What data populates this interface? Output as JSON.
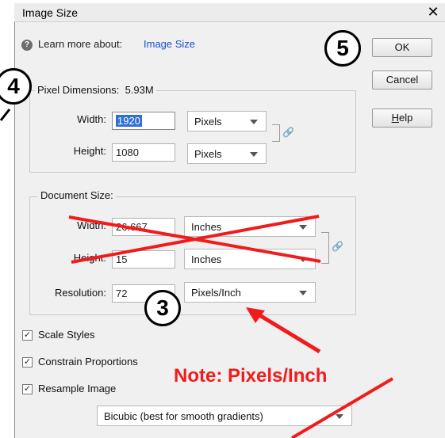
{
  "dialog": {
    "title": "Image Size",
    "close_glyph": "✕",
    "learn_more": {
      "icon": "help-icon",
      "text": "Learn more about:",
      "link": "Image Size"
    }
  },
  "buttons": {
    "ok": "OK",
    "cancel": "Cancel",
    "help": "Help"
  },
  "pixel_dimensions": {
    "label": "Pixel Dimensions:",
    "size": "5.93M",
    "width_label": "Width:",
    "width_value": "1920",
    "width_unit": "Pixels",
    "height_label": "Height:",
    "height_value": "1080",
    "height_unit": "Pixels"
  },
  "document_size": {
    "label": "Document Size:",
    "width_label": "Width:",
    "width_value": "26.667",
    "width_unit": "Inches",
    "height_label": "Height:",
    "height_value": "15",
    "height_unit": "Inches",
    "resolution_label": "Resolution:",
    "resolution_value": "72",
    "resolution_unit": "Pixels/Inch"
  },
  "options": {
    "scale_styles": {
      "label": "Scale Styles",
      "checked": true
    },
    "constrain_proportions": {
      "label": "Constrain Proportions",
      "checked": true
    },
    "resample_image": {
      "label": "Resample Image",
      "checked": true
    },
    "resample_method": "Bicubic (best for smooth gradients)"
  },
  "annotations": {
    "step3": "3",
    "step4": "4",
    "step5": "5",
    "note": "Note: Pixels/Inch",
    "annotation_color": "#f21b1b"
  },
  "icons": {
    "link": "chain-link-icon",
    "check": "✓",
    "help": "?"
  }
}
